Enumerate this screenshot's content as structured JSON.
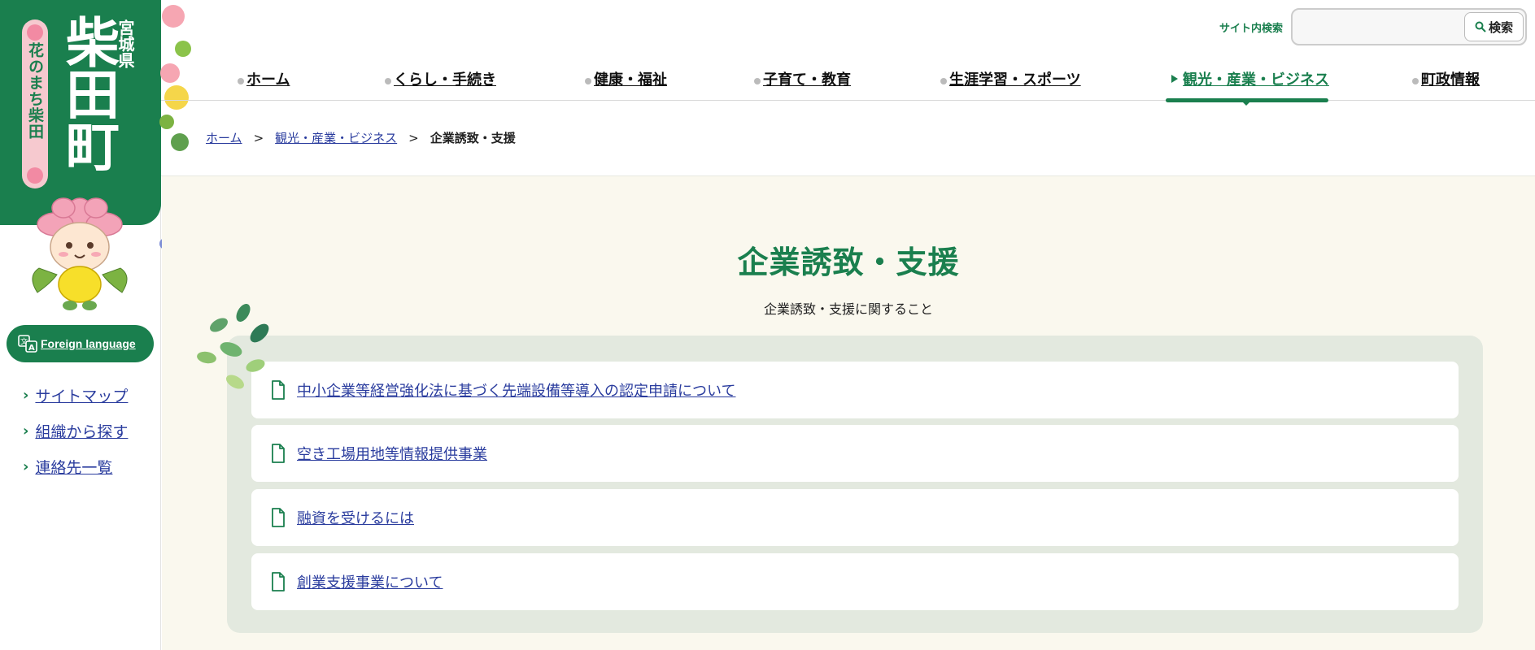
{
  "logo": {
    "main": "柴田町",
    "prefecture": "宮城県",
    "sub": "花のまち柴田"
  },
  "sidebar": {
    "foreign_language": "Foreign language",
    "links": [
      {
        "label": "サイトマップ"
      },
      {
        "label": "組織から探す"
      },
      {
        "label": "連絡先一覧"
      }
    ]
  },
  "search": {
    "label": "サイト内検索",
    "button": "検索",
    "placeholder": ""
  },
  "nav": {
    "items": [
      {
        "label": "ホーム"
      },
      {
        "label": "くらし・手続き"
      },
      {
        "label": "健康・福祉"
      },
      {
        "label": "子育て・教育"
      },
      {
        "label": "生涯学習・スポーツ"
      },
      {
        "label": "観光・産業・ビジネス",
        "active": true
      },
      {
        "label": "町政情報"
      }
    ]
  },
  "breadcrumb": {
    "items": [
      "ホーム",
      "観光・産業・ビジネス"
    ],
    "separator": ">",
    "current": "企業誘致・支援"
  },
  "main": {
    "title": "企業誘致・支援",
    "description": "企業誘致・支援に関すること",
    "links": [
      {
        "label": "中小企業等経営強化法に基づく先端設備等導入の認定申請について"
      },
      {
        "label": "空き工場用地等情報提供事業"
      },
      {
        "label": "融資を受けるには"
      },
      {
        "label": "創業支援事業について"
      }
    ]
  },
  "colors": {
    "brand_green": "#1a7f4e",
    "link_blue": "#2a3c9e",
    "main_bg": "#faf8ee",
    "panel_bg": "#e3e9df"
  }
}
